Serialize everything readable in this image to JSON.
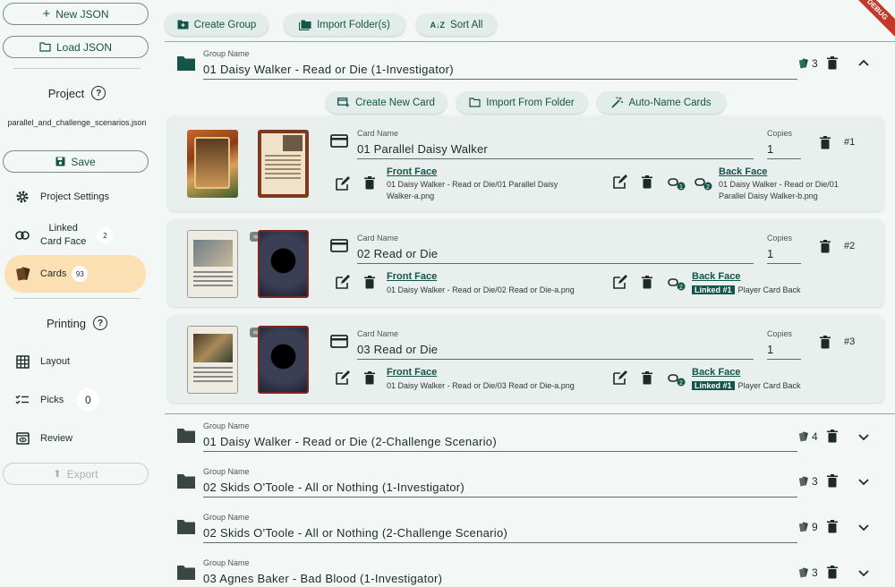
{
  "sidebar": {
    "new_json": "New JSON",
    "load_json": "Load JSON",
    "project_title": "Project",
    "filename": "parallel_and_challenge_scenarios.json",
    "save": "Save",
    "project_settings": "Project Settings",
    "linked_card_face": "Linked\nCard Face",
    "linked_card_face_l1": "Linked",
    "linked_card_face_l2": "Card Face",
    "linked_count": "2",
    "cards": "Cards",
    "cards_count": "93",
    "printing_title": "Printing",
    "layout": "Layout",
    "picks": "Picks",
    "picks_count": "0",
    "review": "Review",
    "export": "Export"
  },
  "toolbar": {
    "create_group": "Create Group",
    "import_folders": "Import Folder(s)",
    "sort_all": "Sort All"
  },
  "group_label": "Group Name",
  "open_group": {
    "name": "01 Daisy Walker - Read or Die (1-Investigator)",
    "count": "3",
    "create_new_card": "Create New Card",
    "import_from_folder": "Import From Folder",
    "auto_name_cards": "Auto-Name Cards"
  },
  "card_label": "Card Name",
  "copies_label": "Copies",
  "front_face_label": "Front Face",
  "back_face_label": "Back Face",
  "cards": [
    {
      "name": "01 Parallel Daisy Walker",
      "copies": "1",
      "index": "#1",
      "front_path": "01 Daisy Walker - Read or Die/01 Parallel Daisy Walker-a.png",
      "front_path_l1": "01 Daisy Walker - Read or Die/01 Parallel Daisy",
      "front_path_l2": "Walker-a.png",
      "back_path_l1": "01 Daisy Walker - Read or Die/01",
      "back_path_l2": "Parallel Daisy Walker-b.png"
    },
    {
      "name": "02 Read or Die",
      "copies": "1",
      "index": "#2",
      "front_path": "01 Daisy Walker - Read or Die/02 Read or Die-a.png",
      "back_linked": "Linked #1",
      "back_text": "Player Card Back"
    },
    {
      "name": "03 Read or Die",
      "copies": "1",
      "index": "#3",
      "front_path": "01 Daisy Walker - Read or Die/03 Read or Die-a.png",
      "back_linked": "Linked #1",
      "back_text": "Player Card Back"
    }
  ],
  "groups": [
    {
      "name": "01 Daisy Walker - Read or Die (2-Challenge Scenario)",
      "count": "4"
    },
    {
      "name": "02 Skids O'Toole - All or Nothing (1-Investigator)",
      "count": "3"
    },
    {
      "name": "02 Skids O'Toole - All or Nothing (2-Challenge Scenario)",
      "count": "9"
    },
    {
      "name": "03 Agnes Baker - Bad Blood (1-Investigator)",
      "count": "3"
    }
  ],
  "debug_banner": "DEBUG",
  "colors": {
    "accent": "#155448",
    "active_nav": "#fae0b2",
    "background": "#f3f7f5",
    "card_bg": "#e8efec"
  }
}
